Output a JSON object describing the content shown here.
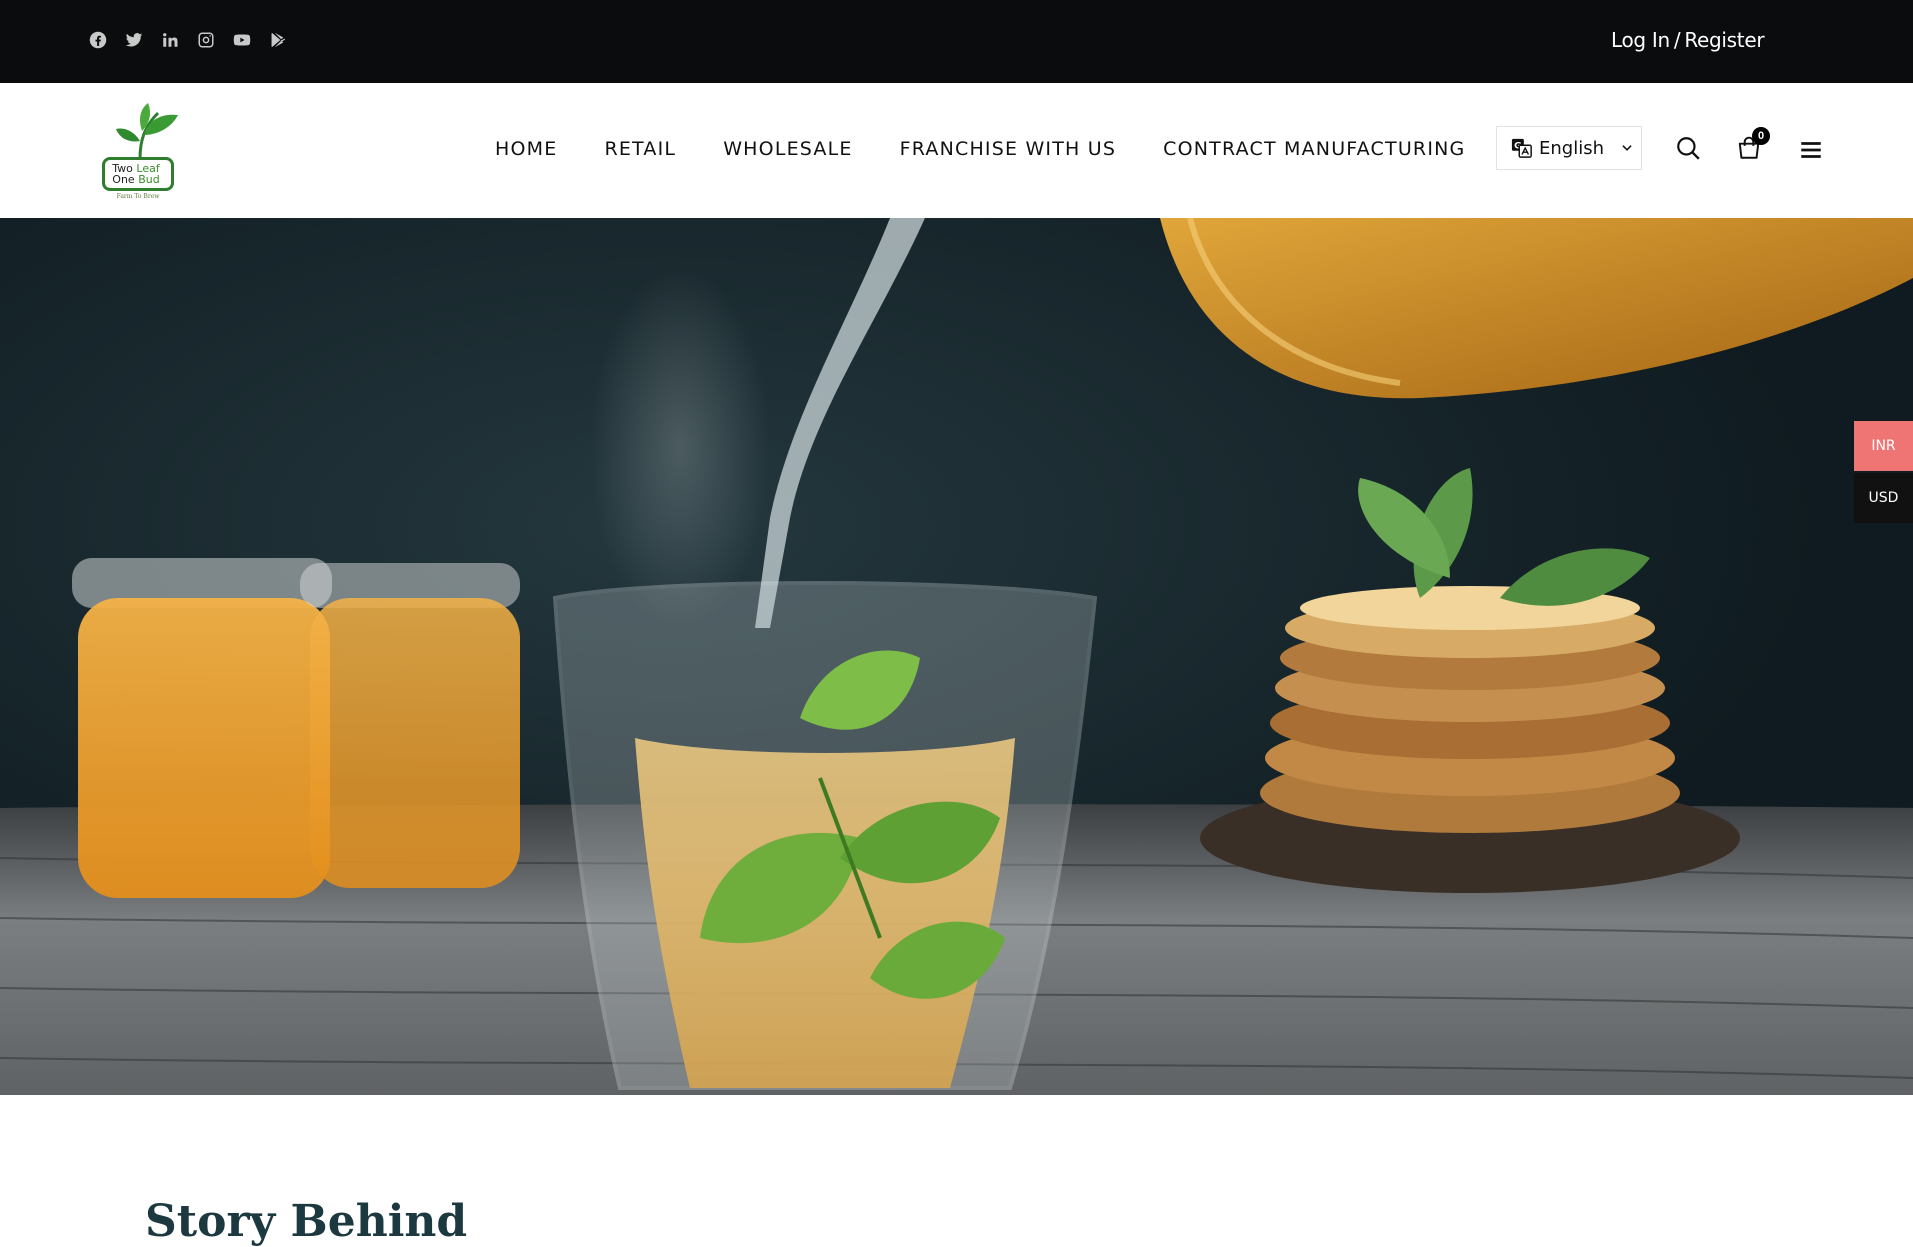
{
  "topbar": {
    "social_icons": [
      "facebook-icon",
      "twitter-icon",
      "linkedin-icon",
      "instagram-icon",
      "youtube-icon",
      "google-play-icon"
    ],
    "login_label": "Log In",
    "separator": "/",
    "register_label": "Register"
  },
  "brand": {
    "logo_line1_a": "Two",
    "logo_line1_b": "Leaf",
    "logo_line2_a": "One",
    "logo_line2_b": "Bud",
    "logo_tagline": "Farm To Brew"
  },
  "nav": {
    "items": [
      "HOME",
      "RETAIL",
      "WHOLESALE",
      "FRANCHISE WITH US",
      "CONTRACT MANUFACTURING"
    ]
  },
  "language": {
    "selected": "English"
  },
  "cart": {
    "count": "0"
  },
  "currency": {
    "options": [
      "INR",
      "USD"
    ],
    "selected": "INR"
  },
  "section": {
    "title": "Story Behind"
  },
  "colors": {
    "topbar_bg": "#0b0c0d",
    "currency_active": "#ef7474",
    "currency_inactive": "#111111",
    "brand_green": "#2f7d2f",
    "heading": "#1d3940"
  }
}
